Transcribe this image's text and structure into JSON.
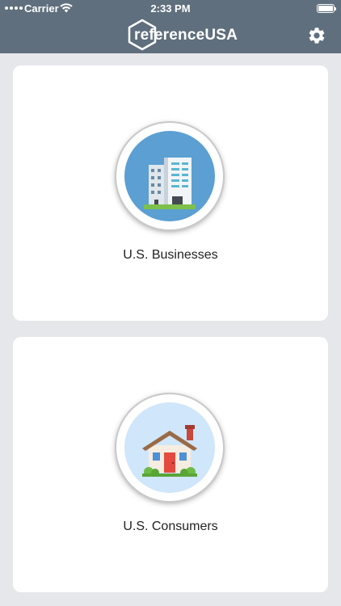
{
  "status_bar": {
    "carrier": "Carrier",
    "time": "2:33 PM"
  },
  "nav": {
    "brand": "referenceUSA",
    "settings_icon": "gear-icon"
  },
  "cards": [
    {
      "label": "U.S. Businesses",
      "icon": "office-buildings-icon",
      "icon_bg": "#5b9fd3"
    },
    {
      "label": "U.S. Consumers",
      "icon": "house-icon",
      "icon_bg": "#cfe6fb"
    }
  ],
  "colors": {
    "header": "#5f6f7d",
    "background": "#e6e7ea",
    "card": "#ffffff"
  }
}
